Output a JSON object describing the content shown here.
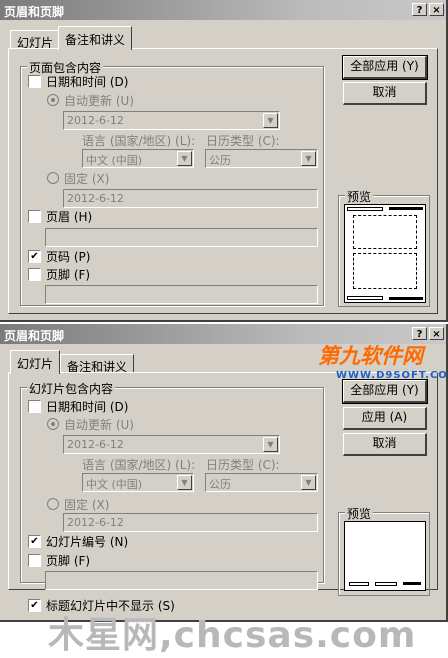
{
  "dialog1": {
    "title": "页眉和页脚",
    "tabs": [
      "幻灯片",
      "备注和讲义"
    ],
    "group_title": "页面包含内容",
    "date_time": "日期和时间 (D)",
    "auto_update": "自动更新 (U)",
    "auto_date": "2012-6-12",
    "language_label": "语言 (国家/地区) (L):",
    "calendar_label": "日历类型 (C):",
    "language_value": "中文 (中国)",
    "calendar_value": "公历",
    "fixed": "固定 (X)",
    "fixed_value": "2012-6-12",
    "header": "页眉 (H)",
    "page_number": "页码 (P)",
    "footer": "页脚 (F)",
    "apply_all": "全部应用 (Y)",
    "cancel": "取消",
    "preview": "预览",
    "page_number_checked": true
  },
  "dialog2": {
    "title": "页眉和页脚",
    "tabs": [
      "幻灯片",
      "备注和讲义"
    ],
    "group_title": "幻灯片包含内容",
    "date_time": "日期和时间 (D)",
    "auto_update": "自动更新 (U)",
    "auto_date": "2012-6-12",
    "language_label": "语言 (国家/地区) (L):",
    "calendar_label": "日历类型 (C):",
    "language_value": "中文 (中国)",
    "calendar_value": "公历",
    "fixed": "固定 (X)",
    "fixed_value": "2012-6-12",
    "slide_number": "幻灯片编号 (N)",
    "footer": "页脚 (F)",
    "hide_title": "标题幻灯片中不显示 (S)",
    "apply_all": "全部应用 (Y)",
    "apply": "应用 (A)",
    "cancel": "取消",
    "preview": "预览",
    "slide_number_checked": true,
    "hide_title_checked": true
  },
  "window_buttons": {
    "help": "?",
    "close": "×"
  },
  "checkmark": "✔",
  "logo": {
    "main": "第九软件网",
    "sub": "WWW.D9SOFT.COM"
  },
  "watermark": "木星网,chcsas.com"
}
